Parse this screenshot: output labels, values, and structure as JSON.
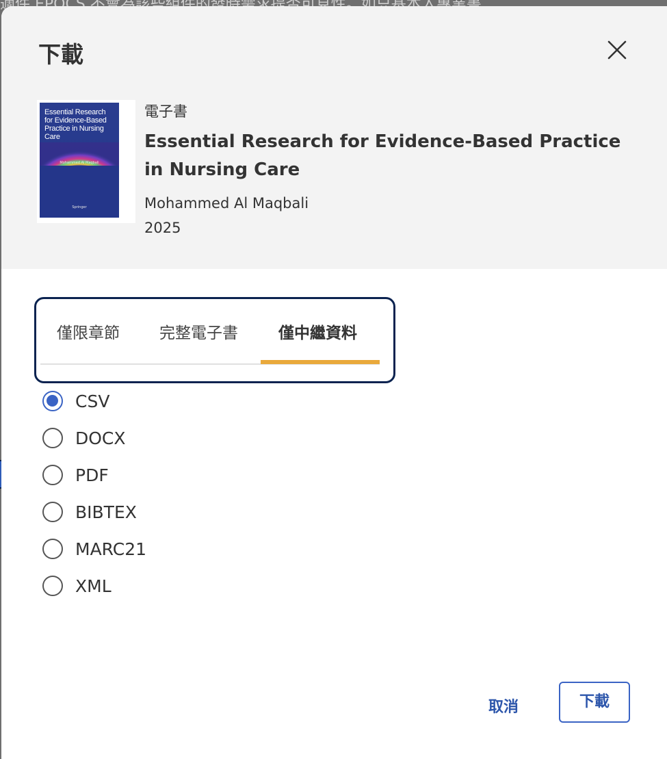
{
  "backdrop": {
    "partial_text": "適件 EPOCS 不會為該些組件的發時需求提否可見性。如只基本入專業書"
  },
  "dialog": {
    "title": "下載",
    "close_icon": "close-icon"
  },
  "book": {
    "type": "電子書",
    "title": "Essential Research for Evidence-Based Practice in Nursing Care",
    "author": "Mohammed Al Maqbali",
    "year": "2025",
    "cover": {
      "title": "Essential Research for Evidence-Based Practice in Nursing Care",
      "author": "Mohammed Al Maqbali",
      "publisher": "Springer",
      "color": "#2a3d8f"
    }
  },
  "tabs": [
    {
      "label": "僅限章節",
      "active": false
    },
    {
      "label": "完整電子書",
      "active": false
    },
    {
      "label": "僅中繼資料",
      "active": true
    }
  ],
  "formats": [
    {
      "label": "CSV",
      "checked": true
    },
    {
      "label": "DOCX",
      "checked": false
    },
    {
      "label": "PDF",
      "checked": false
    },
    {
      "label": "BIBTEX",
      "checked": false
    },
    {
      "label": "MARC21",
      "checked": false
    },
    {
      "label": "XML",
      "checked": false
    }
  ],
  "actions": {
    "cancel_label": "取消",
    "download_label": "下載"
  },
  "colors": {
    "accent": "#3a63c4",
    "tab_indicator": "#e9a93b",
    "focus_outline": "#0b2350"
  }
}
